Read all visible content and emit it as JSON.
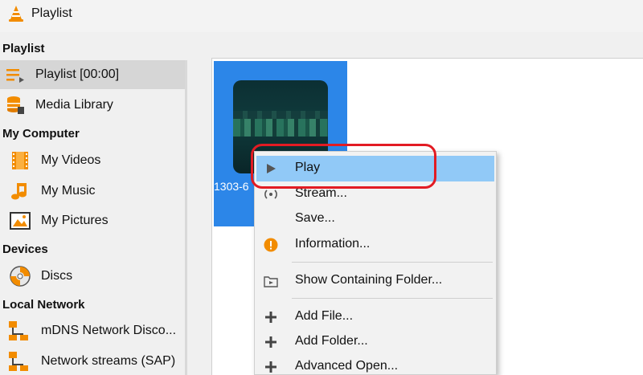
{
  "window": {
    "title": "Playlist"
  },
  "sidebar": {
    "sections": {
      "playlist": "Playlist",
      "my_computer": "My Computer",
      "devices": "Devices",
      "local_network": "Local Network"
    },
    "items": {
      "playlist": {
        "label": "Playlist [00:00]",
        "icon": "playlist-icon",
        "selected": true
      },
      "media_library": {
        "label": "Media Library",
        "icon": "database-icon"
      },
      "my_videos": {
        "label": "My Videos",
        "icon": "film-icon"
      },
      "my_music": {
        "label": "My Music",
        "icon": "music-note-icon"
      },
      "my_pictures": {
        "label": "My Pictures",
        "icon": "picture-icon"
      },
      "discs": {
        "label": "Discs",
        "icon": "disc-icon"
      },
      "mdns": {
        "label": "mDNS Network Disco...",
        "icon": "network-icon"
      },
      "sap": {
        "label": "Network streams (SAP)",
        "icon": "network-icon"
      }
    }
  },
  "main": {
    "tile": {
      "label": "1303-6"
    }
  },
  "context_menu": {
    "items": {
      "play": {
        "label": "Play",
        "icon": "play-icon",
        "highlighted": true
      },
      "stream": {
        "label": "Stream...",
        "icon": "stream-icon"
      },
      "save": {
        "label": "Save..."
      },
      "information": {
        "label": "Information...",
        "icon": "info-icon"
      },
      "show_folder": {
        "label": "Show Containing Folder...",
        "icon": "folder-icon"
      },
      "add_file": {
        "label": "Add File...",
        "icon": "plus-icon"
      },
      "add_folder": {
        "label": "Add Folder...",
        "icon": "plus-icon"
      },
      "advanced_open": {
        "label": "Advanced Open...",
        "icon": "plus-icon"
      }
    }
  },
  "colors": {
    "selection_blue": "#2c86e8",
    "menu_highlight": "#91c9f7",
    "annotation_red": "#e21b23",
    "vlc_orange": "#f28c00"
  }
}
